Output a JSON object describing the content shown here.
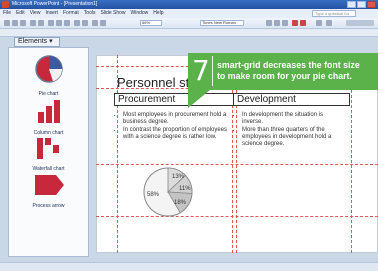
{
  "window": {
    "title": "Microsoft PowerPoint - [Presentation1]"
  },
  "menubar": {
    "items": [
      "File",
      "Edit",
      "View",
      "Insert",
      "Format",
      "Tools",
      "Slide Show",
      "Window",
      "Help"
    ],
    "help_placeholder": "Type a question for help"
  },
  "toolbar": {
    "font": "Times New Roman",
    "zoom": "66%"
  },
  "elements_panel": {
    "tab_label": "Elements",
    "items": [
      {
        "label": "Pie chart",
        "icon": "pie-chart-icon"
      },
      {
        "label": "Column chart",
        "icon": "column-chart-icon"
      },
      {
        "label": "Waterfall chart",
        "icon": "waterfall-chart-icon"
      },
      {
        "label": "Process arrow",
        "icon": "process-arrow-icon"
      }
    ]
  },
  "slide": {
    "title": "Personnel st",
    "columns": [
      {
        "header": "Procurement",
        "bullets": [
          "Most employees in procurement hold a business degree.",
          "In contrast the proportion of employees with a science degree is rather low."
        ]
      },
      {
        "header": "Development",
        "bullets": [
          "In development the situation is inverse.",
          "More than three quarters of the employees in development hold a science degree."
        ]
      }
    ],
    "pie": {
      "labels": [
        "13%",
        "11%",
        "18%",
        "58%"
      ],
      "values": [
        13,
        11,
        18,
        58
      ]
    }
  },
  "callout": {
    "number": "7",
    "line1": "smart-grid decreases the font size",
    "line2": "to make room for your pie chart."
  },
  "colors": {
    "accent_green": "#5bb24a",
    "guide_red": "#e05858",
    "pie_grey": "#d4d4d4"
  }
}
